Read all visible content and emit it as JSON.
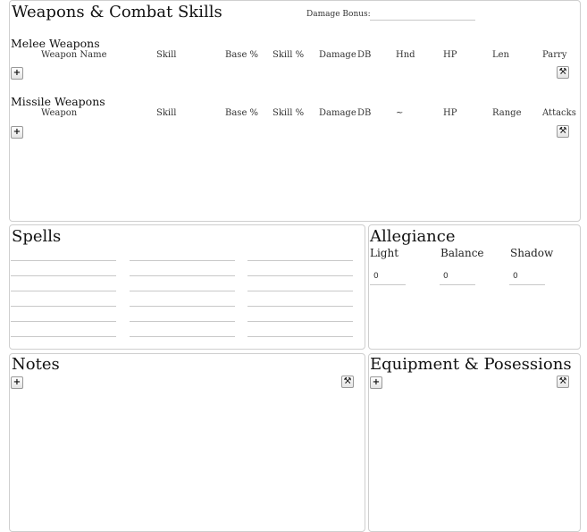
{
  "weapons": {
    "title": "Weapons & Combat Skills",
    "damage_bonus_label": "Damage Bonus:",
    "damage_bonus_value": "",
    "melee": {
      "title": "Melee Weapons",
      "columns": [
        "Weapon Name",
        "Skill",
        "Base %",
        "Skill %",
        "Damage",
        "DB",
        "Hnd",
        "HP",
        "Len",
        "Parry"
      ]
    },
    "missile": {
      "title": "Missile Weapons",
      "columns": [
        "Weapon",
        "Skill",
        "Base %",
        "Skill %",
        "Damage",
        "DB",
        "~",
        "HP",
        "Range",
        "Attacks"
      ]
    }
  },
  "spells": {
    "title": "Spells"
  },
  "allegiance": {
    "title": "Allegiance",
    "items": [
      {
        "label": "Light",
        "value": "0"
      },
      {
        "label": "Balance",
        "value": "0"
      },
      {
        "label": "Shadow",
        "value": "0"
      }
    ]
  },
  "notes": {
    "title": "Notes"
  },
  "equipment": {
    "title": "Equipment & Posessions"
  },
  "icons": {
    "add": "plus-icon",
    "edit": "tools-icon"
  },
  "glyphs": {
    "add": "+",
    "edit": "⚒"
  }
}
